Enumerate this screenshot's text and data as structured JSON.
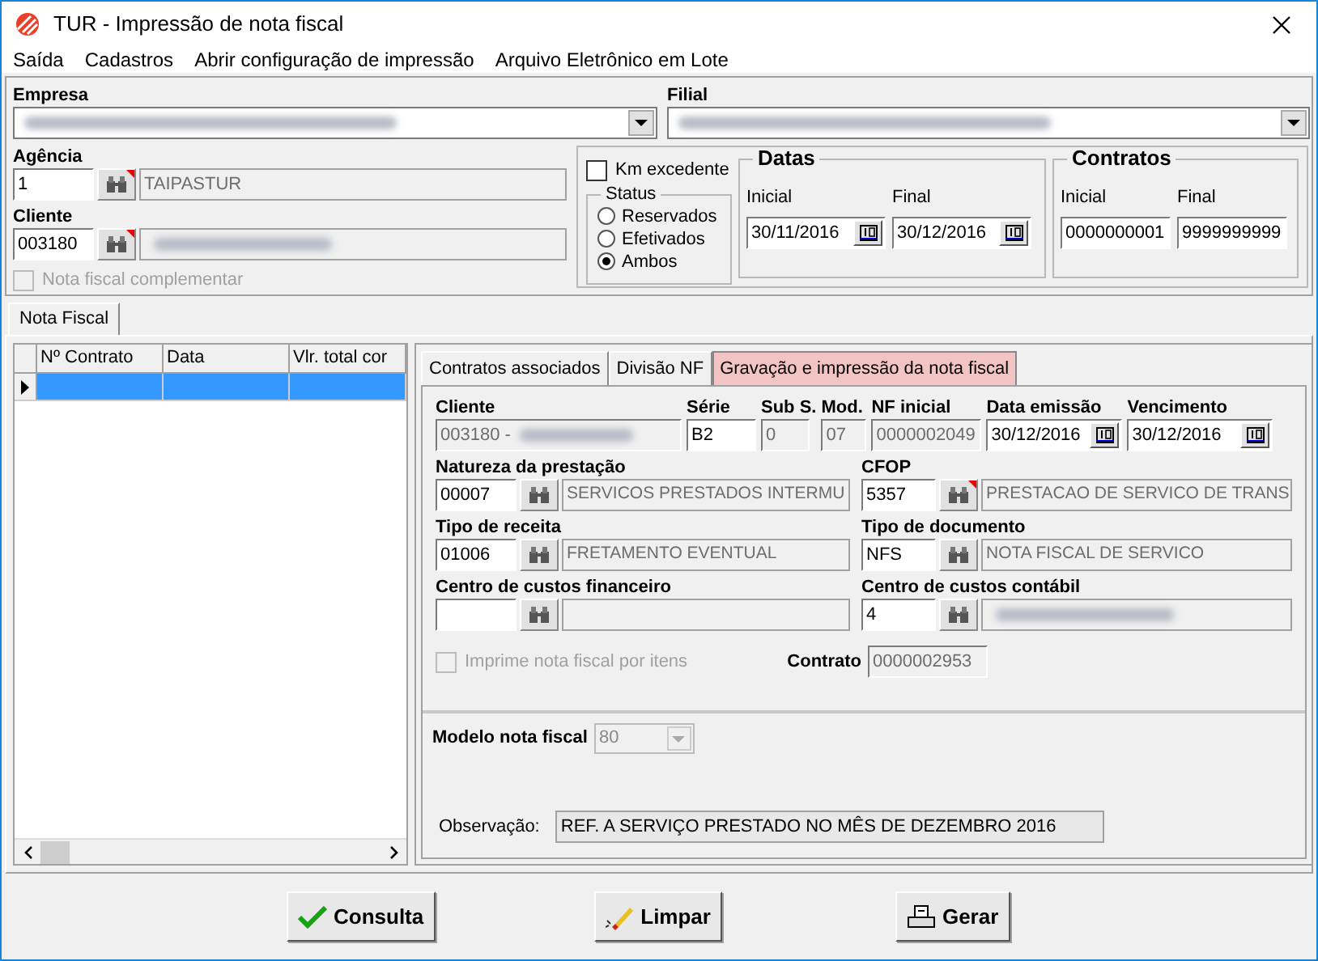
{
  "window": {
    "title": "TUR - Impressão de nota fiscal"
  },
  "menu": [
    "Saída",
    "Cadastros",
    "Abrir configuração de impressão",
    "Arquivo Eletrônico em Lote"
  ],
  "empresa": {
    "label": "Empresa",
    "redacted": true
  },
  "filial": {
    "label": "Filial",
    "redacted": true
  },
  "agencia": {
    "label": "Agência",
    "code": "1",
    "description": "TAIPASTUR",
    "flagged": true,
    "redacted": false
  },
  "cliente": {
    "label": "Cliente",
    "code": "003180",
    "flagged": true,
    "redacted": true
  },
  "nota_complementar": {
    "label": "Nota fiscal complementar",
    "checked": false,
    "disabled": true
  },
  "km_excedente": {
    "label": "Km excedente",
    "checked": false,
    "disabled": false
  },
  "status": {
    "title": "Status",
    "options": [
      {
        "label": "Reservados",
        "selected": false
      },
      {
        "label": "Efetivados",
        "selected": false
      },
      {
        "label": "Ambos",
        "selected": true
      }
    ]
  },
  "datas": {
    "title": "Datas",
    "fields": [
      {
        "label": "Inicial",
        "value": "30/11/2016"
      },
      {
        "label": "Final",
        "value": "30/12/2016"
      }
    ]
  },
  "contratos": {
    "title": "Contratos",
    "fields": [
      {
        "label": "Inicial",
        "value": "0000000001"
      },
      {
        "label": "Final",
        "value": "9999999999"
      }
    ]
  },
  "main_tabs": [
    {
      "label": "Nota Fiscal",
      "selected": true
    }
  ],
  "grid": {
    "columns": [
      "Nº Contrato",
      "Data",
      "Vlr. total cor"
    ],
    "rows": [
      {
        "cells": [
          "",
          "",
          ""
        ],
        "selected": true
      }
    ]
  },
  "sub_tabs": [
    {
      "label": "Contratos associados",
      "selected": false
    },
    {
      "label": "Divisão NF",
      "selected": false
    },
    {
      "label": "Gravação e impressão da nota fiscal",
      "selected": true
    }
  ],
  "header_fields": [
    {
      "label": "Cliente",
      "value": "003180 -",
      "disabled": true,
      "redacted": true,
      "kind": "text"
    },
    {
      "label": "Série",
      "value": "B2",
      "disabled": false,
      "redacted": false,
      "kind": "text"
    },
    {
      "label": "Sub S.",
      "value": "0",
      "disabled": true,
      "redacted": false,
      "kind": "text"
    },
    {
      "label": "Mod.",
      "value": "07",
      "disabled": true,
      "redacted": false,
      "kind": "text"
    },
    {
      "label": "NF inicial",
      "value": "0000002049",
      "disabled": true,
      "redacted": false,
      "kind": "text"
    },
    {
      "label": "Data emissão",
      "value": "30/12/2016",
      "disabled": false,
      "redacted": false,
      "kind": "date"
    },
    {
      "label": "Vencimento",
      "value": "30/12/2016",
      "disabled": false,
      "redacted": false,
      "kind": "date"
    }
  ],
  "lookups": [
    {
      "label": "Natureza da prestação",
      "code": "00007",
      "description": "SERVICOS PRESTADOS INTERMU",
      "flagged": false,
      "redacted": false
    },
    {
      "label": "CFOP",
      "code": "5357",
      "description": "PRESTACAO DE SERVICO DE TRANS",
      "flagged": true,
      "redacted": false
    },
    {
      "label": "Tipo de receita",
      "code": "01006",
      "description": "FRETAMENTO EVENTUAL",
      "flagged": false,
      "redacted": false
    },
    {
      "label": "Tipo de documento",
      "code": "NFS",
      "description": "NOTA FISCAL DE SERVICO",
      "flagged": false,
      "redacted": false
    },
    {
      "label": "Centro de custos financeiro",
      "flagged": false,
      "redacted": false
    },
    {
      "label": "Centro de custos contábil",
      "code": "4",
      "flagged": false,
      "redacted": true
    }
  ],
  "imprime_por_itens": {
    "label": "Imprime nota fiscal por itens",
    "checked": false,
    "disabled": true
  },
  "contrato": {
    "label": "Contrato",
    "value": "0000002953"
  },
  "modelo": {
    "label": "Modelo nota fiscal",
    "value": "80"
  },
  "observacao": {
    "label": "Observação:",
    "value": "REF. A SERVIÇO PRESTADO NO MÊS DE DEZEMBRO 2016"
  },
  "buttons": [
    {
      "label": "Consulta",
      "kind": "check"
    },
    {
      "label": "Limpar",
      "kind": "eraser"
    },
    {
      "label": "Gerar",
      "kind": "printer"
    }
  ]
}
